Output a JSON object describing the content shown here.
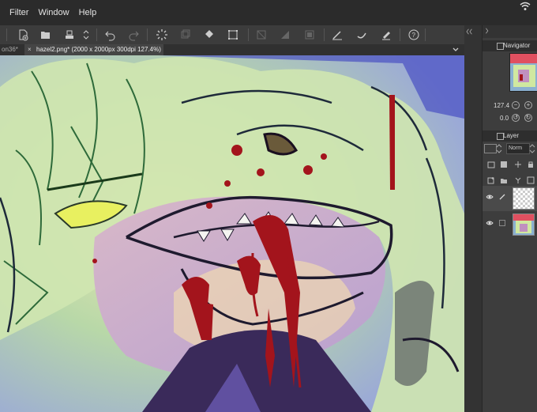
{
  "menubar": {
    "items": [
      "Filter",
      "Window",
      "Help"
    ]
  },
  "tabs": {
    "inactive_label": "on36*",
    "active_label": "hazel2.png* (2000 x 2000px 300dpi 127.4%)"
  },
  "panels": {
    "navigator_label": "Navigator",
    "zoom_value": "127.4",
    "angle_value": "0.0",
    "layer_label": "Layer",
    "blend_mode": "Norm"
  },
  "colors": {
    "canvas_bg": "#7c85d6",
    "accent_blood": "#a3141c",
    "hair_green": "#c8e0a0",
    "line_dark": "#2a1a3a"
  },
  "icons": {
    "new": "new-file-icon",
    "open": "open-folder-icon",
    "save": "save-icon",
    "undo": "undo-icon",
    "redo": "redo-icon"
  }
}
